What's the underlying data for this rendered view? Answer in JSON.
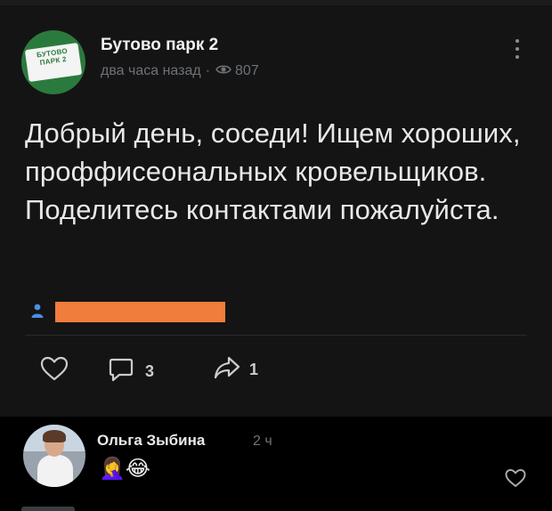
{
  "post": {
    "community_name": "Бутово парк 2",
    "avatar_text": "БУТОВО ПАРК 2",
    "time": "два часа назад",
    "separator": "·",
    "views": "807",
    "text": "Добрый день, соседи! Ищем хороших, проффисеональных кровельщиков. Поделитесь контактами пожалуйста.",
    "redaction_color": "#f07d3c",
    "actions": {
      "like_icon": "heart-icon",
      "comment_icon": "comment-icon",
      "comment_count": "3",
      "share_icon": "share-icon",
      "share_count": "1"
    }
  },
  "comment": {
    "author": "Ольга Зыбина",
    "time": "2 ч",
    "text": "🤦‍♀️😂",
    "like_icon": "heart-icon"
  },
  "colors": {
    "background": "#000000",
    "post_background": "#141414",
    "text_primary": "#e7e8ea",
    "text_secondary": "#6d7278",
    "brand_green": "#2b7a3d"
  }
}
